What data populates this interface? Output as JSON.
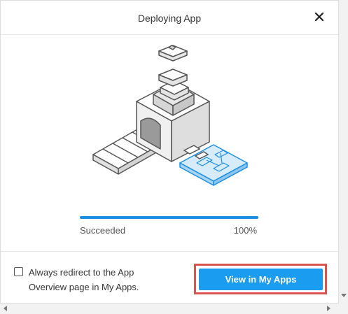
{
  "dialog": {
    "title": "Deploying App",
    "close_icon": "close-icon"
  },
  "illustration": {
    "icon": "app-factory-illustration",
    "accent_color": "#1b8fe0"
  },
  "progress": {
    "value_percent": 100,
    "status": "Succeeded",
    "percent_label": "100%",
    "fill_color": "#1b8fe0"
  },
  "footer": {
    "checkbox_checked": false,
    "checkbox_label": "Always redirect to the App Overview page in My Apps.",
    "primary_button_label": "View in My Apps",
    "primary_button_color": "#1a9cf0",
    "highlight_color": "#d9534f"
  },
  "scrollbars": {
    "down_arrow_icon": "arrow-down-icon",
    "left_arrow_icon": "arrow-left-icon",
    "right_arrow_icon": "arrow-right-icon"
  }
}
